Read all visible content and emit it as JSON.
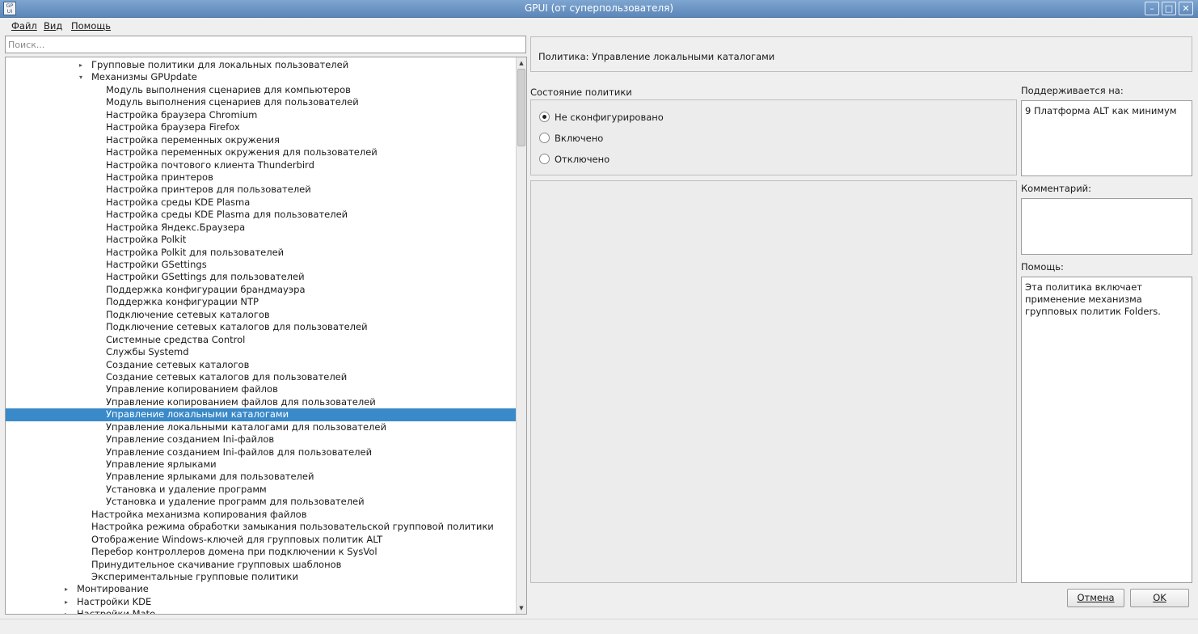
{
  "window": {
    "icon_text": "GP UI",
    "title": "GPUI (от суперпользователя)",
    "minimize_glyph": "–",
    "maximize_glyph": "□",
    "close_glyph": "✕"
  },
  "menu": {
    "file": "Файл",
    "view": "Вид",
    "help": "Помощь"
  },
  "search": {
    "placeholder": "Поиск...",
    "value": ""
  },
  "tree": {
    "rows": [
      {
        "label": "Групповые политики для локальных пользователей",
        "level": 5,
        "expander": "collapsed"
      },
      {
        "label": "Механизмы GPUpdate",
        "level": 5,
        "expander": "expanded"
      },
      {
        "label": "Модуль выполнения сценариев для компьютеров",
        "level": 6,
        "expander": "none"
      },
      {
        "label": "Модуль выполнения сценариев для пользователей",
        "level": 6,
        "expander": "none"
      },
      {
        "label": "Настройка браузера Chromium",
        "level": 6,
        "expander": "none"
      },
      {
        "label": "Настройка браузера Firefox",
        "level": 6,
        "expander": "none"
      },
      {
        "label": "Настройка переменных окружения",
        "level": 6,
        "expander": "none"
      },
      {
        "label": "Настройка переменных окружения для пользователей",
        "level": 6,
        "expander": "none"
      },
      {
        "label": "Настройка почтового клиента Thunderbird",
        "level": 6,
        "expander": "none"
      },
      {
        "label": "Настройка принтеров",
        "level": 6,
        "expander": "none"
      },
      {
        "label": "Настройка принтеров для пользователей",
        "level": 6,
        "expander": "none"
      },
      {
        "label": "Настройка среды KDE Plasma",
        "level": 6,
        "expander": "none"
      },
      {
        "label": "Настройка среды KDE Plasma для пользователей",
        "level": 6,
        "expander": "none"
      },
      {
        "label": "Настройка Яндекс.Браузера",
        "level": 6,
        "expander": "none"
      },
      {
        "label": "Настройка Polkit",
        "level": 6,
        "expander": "none"
      },
      {
        "label": "Настройка Polkit для пользователей",
        "level": 6,
        "expander": "none"
      },
      {
        "label": "Настройки GSettings",
        "level": 6,
        "expander": "none"
      },
      {
        "label": "Настройки GSettings для пользователей",
        "level": 6,
        "expander": "none"
      },
      {
        "label": "Поддержка конфигурации брандмауэра",
        "level": 6,
        "expander": "none"
      },
      {
        "label": "Поддержка конфигурации NTP",
        "level": 6,
        "expander": "none"
      },
      {
        "label": "Подключение сетевых каталогов",
        "level": 6,
        "expander": "none"
      },
      {
        "label": "Подключение сетевых каталогов для пользователей",
        "level": 6,
        "expander": "none"
      },
      {
        "label": "Системные средства Control",
        "level": 6,
        "expander": "none"
      },
      {
        "label": "Службы Systemd",
        "level": 6,
        "expander": "none"
      },
      {
        "label": "Создание сетевых каталогов",
        "level": 6,
        "expander": "none"
      },
      {
        "label": "Создание сетевых каталогов для пользователей",
        "level": 6,
        "expander": "none"
      },
      {
        "label": "Управление копированием файлов",
        "level": 6,
        "expander": "none"
      },
      {
        "label": "Управление копированием файлов для пользователей",
        "level": 6,
        "expander": "none"
      },
      {
        "label": "Управление локальными каталогами",
        "level": 6,
        "expander": "none",
        "selected": true
      },
      {
        "label": "Управление локальными каталогами для пользователей",
        "level": 6,
        "expander": "none"
      },
      {
        "label": "Управление созданием Ini-файлов",
        "level": 6,
        "expander": "none"
      },
      {
        "label": "Управление созданием Ini-файлов для пользователей",
        "level": 6,
        "expander": "none"
      },
      {
        "label": "Управление ярлыками",
        "level": 6,
        "expander": "none"
      },
      {
        "label": "Управление ярлыками для пользователей",
        "level": 6,
        "expander": "none"
      },
      {
        "label": "Установка и удаление программ",
        "level": 6,
        "expander": "none"
      },
      {
        "label": "Установка и удаление программ для пользователей",
        "level": 6,
        "expander": "none"
      },
      {
        "label": "Настройка механизма копирования файлов",
        "level": 5,
        "expander": "none"
      },
      {
        "label": "Настройка режима обработки замыкания пользовательской групповой политики",
        "level": 5,
        "expander": "none"
      },
      {
        "label": "Отображение Windows-ключей для групповых политик ALT",
        "level": 5,
        "expander": "none"
      },
      {
        "label": "Перебор контроллеров домена при подключении к SysVol",
        "level": 5,
        "expander": "none"
      },
      {
        "label": "Принудительное скачивание групповых шаблонов",
        "level": 5,
        "expander": "none"
      },
      {
        "label": "Экспериментальные групповые политики",
        "level": 5,
        "expander": "none"
      },
      {
        "label": "Монтирование",
        "level": 4,
        "expander": "collapsed"
      },
      {
        "label": "Настройки KDE",
        "level": 4,
        "expander": "collapsed"
      },
      {
        "label": "Настройки Mate",
        "level": 4,
        "expander": "collapsed"
      }
    ],
    "scroll_up_glyph": "▲",
    "scroll_down_glyph": "▼"
  },
  "policy": {
    "header": "Политика: Управление локальными каталогами",
    "state_label": "Состояние политики",
    "options": [
      "Не сконфигурировано",
      "Включено",
      "Отключено"
    ],
    "selected_option": 0,
    "supported_label": "Поддерживается на:",
    "supported_value": "9 Платформа ALT как минимум",
    "comment_label": "Комментарий:",
    "comment_value": "",
    "help_label": "Помощь:",
    "help_value": "Эта политика включает применение механизма групповых политик Folders."
  },
  "buttons": {
    "cancel": "Отмена",
    "ok": "OK"
  },
  "icons": {
    "expander_collapsed": "▸",
    "expander_expanded": "▾"
  },
  "colors": {
    "selection": "#3a8ac9",
    "titlebar": "#6b93c4"
  }
}
